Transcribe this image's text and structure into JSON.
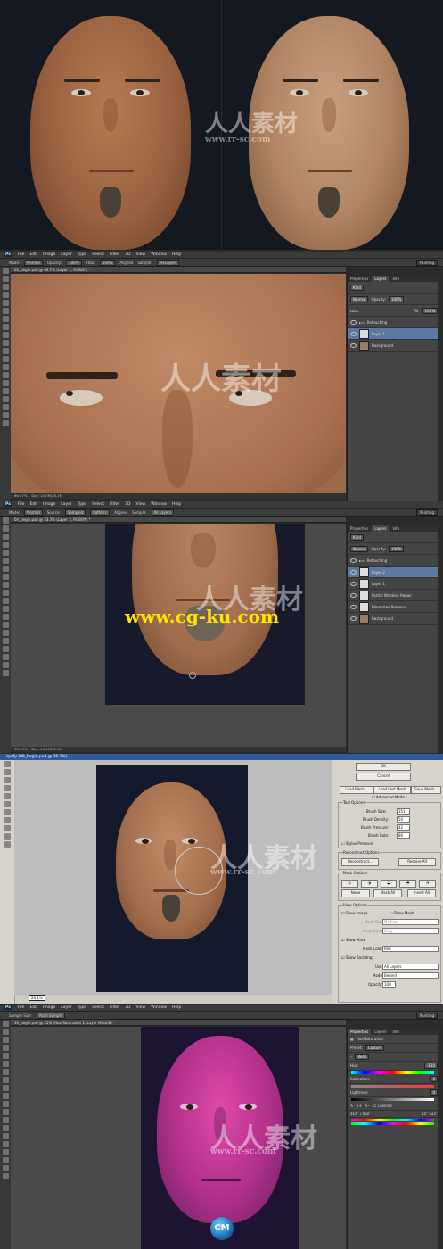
{
  "top": {
    "watermark_cn": "人人素材",
    "watermark_url": "www.rr-sc.com"
  },
  "app": {
    "menu": [
      "File",
      "Edit",
      "Image",
      "Layer",
      "Type",
      "Select",
      "Filter",
      "3D",
      "View",
      "Window",
      "Help"
    ],
    "workspace": "Painting"
  },
  "panel1": {
    "options": [
      "Mode:",
      "Normal",
      "Opacity:",
      "100%",
      "Flow:",
      "100%",
      "Aligned",
      "Sample:",
      "All Layers"
    ],
    "doc_tab": "02_begin.psd @ 66.7% (Layer 1, RGB/8*) *",
    "status_zoom": "66.67%",
    "status_doc": "Doc: 14.0M/28.2M",
    "panel_tabs": [
      "Properties",
      "Layers",
      "Info"
    ],
    "layer_kind": "Kind",
    "blend": "Normal",
    "opacity_label": "Opacity:",
    "opacity": "100%",
    "lock_label": "Lock:",
    "fill_label": "Fill:",
    "fill": "100%",
    "layers": [
      "Retouching",
      "Layer 1",
      "Background"
    ]
  },
  "panel2": {
    "options": [
      "Mode:",
      "Normal",
      "Source:",
      "Sampled",
      "Pattern:",
      "Aligned",
      "Sample:",
      "All Layers"
    ],
    "doc_tab": "04_begin.psd @ 33.3% (Layer 2, RGB/8*) *",
    "status_zoom": "33.33%",
    "status_doc": "Doc: 14.0M/52.0M",
    "layers": [
      "Retouching",
      "Layer 2",
      "Layer 1",
      "Partial Wrinkles Repair",
      "Blemishes Removal",
      "Background"
    ],
    "overlay_url": "www.cg-ku.com"
  },
  "panel3": {
    "title": "Liquify (08_begin.psd @ 26.1%)",
    "zoom": "26.1%",
    "buttons": {
      "ok": "OK",
      "cancel": "Cancel",
      "load_mesh": "Load Mesh...",
      "load_last": "Load Last Mesh",
      "save_mesh": "Save Mesh...",
      "reconstruct": "Reconstruct...",
      "restore_all": "Restore All",
      "none": "None",
      "mask_all": "Mask All",
      "invert_all": "Invert All"
    },
    "advanced_mode": "Advanced Mode",
    "tool_options": "Tool Options",
    "brush_size_label": "Brush Size:",
    "brush_size": "351",
    "brush_density_label": "Brush Density:",
    "brush_density": "50",
    "brush_pressure_label": "Brush Pressure:",
    "brush_pressure": "42",
    "brush_rate_label": "Brush Rate:",
    "brush_rate": "80",
    "stylus": "Stylus Pressure",
    "reconstruct_options": "Reconstruct Options",
    "mask_options": "Mask Options",
    "view_options": "View Options",
    "show_image": "Show Image",
    "show_mesh": "Show Mesh",
    "mesh_size_label": "Mesh Size:",
    "mesh_size": "Medium",
    "mesh_color_label": "Mesh Color:",
    "mesh_color": "Gray",
    "show_mask": "Show Mask",
    "mask_color_label": "Mask Color:",
    "mask_color": "Red",
    "show_backdrop": "Show Backdrop",
    "use_label": "Use:",
    "use": "All Layers",
    "mode_label": "Mode:",
    "mode": "Behind",
    "opacity_label": "Opacity:",
    "opacity": "100"
  },
  "panel4": {
    "options": [
      "Sample Size:",
      "Point Sample"
    ],
    "doc_tab": "10_begin.psd @ 25% (Hue/Saturation 1, Layer Mask/8) *",
    "panel_tabs": [
      "Properties",
      "Layers",
      "Info"
    ],
    "adj_title": "Hue/Saturation",
    "preset_label": "Preset:",
    "preset": "Custom",
    "channel": "Reds",
    "hue_label": "Hue:",
    "hue": "-180",
    "sat_label": "Saturation:",
    "sat": "0",
    "light_label": "Lightness:",
    "light": "0",
    "colorize": "Colorize",
    "range_left": "316° / 346°",
    "range_right": "15° \\ 45°"
  },
  "colors": {
    "ps_blue": "#3fa8ff",
    "layer_selected": "#5a78a0",
    "liquify_title": "#2e5a9e",
    "cgku_yellow": "#ffe400"
  }
}
